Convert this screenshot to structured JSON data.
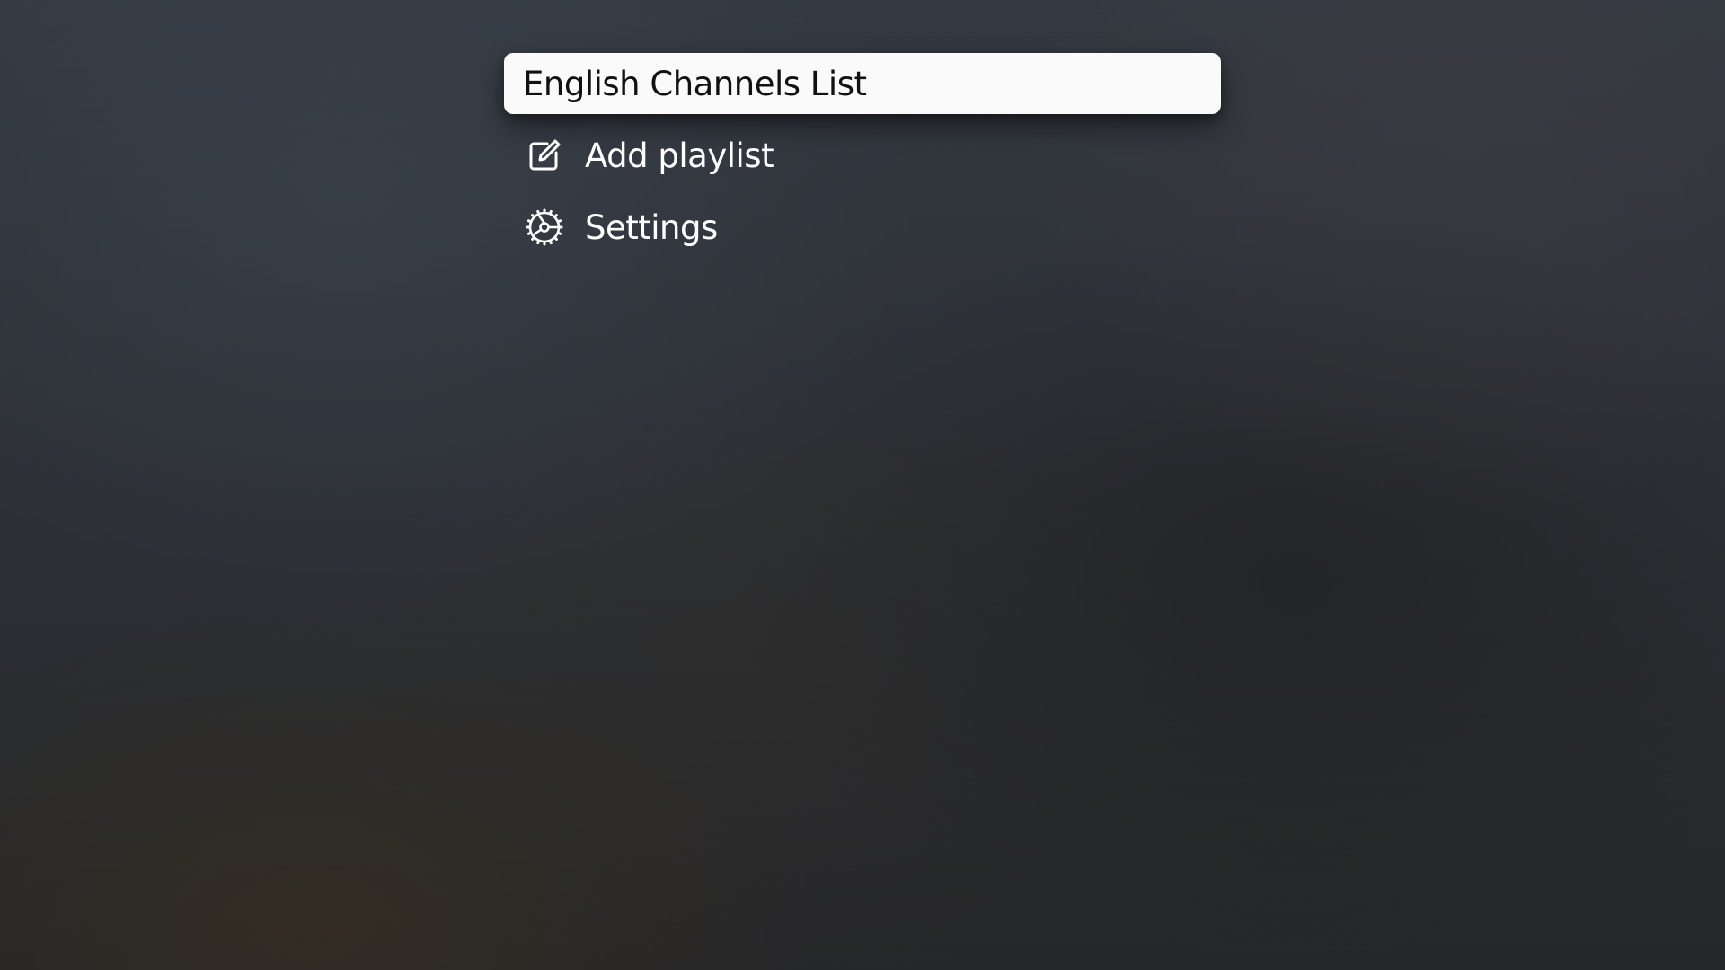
{
  "menu": {
    "items": [
      {
        "label": "English Channels List",
        "icon": null,
        "selected": true
      },
      {
        "label": "Add playlist",
        "icon": "edit-square-icon",
        "selected": false
      },
      {
        "label": "Settings",
        "icon": "gear-icon",
        "selected": false
      }
    ]
  },
  "colors": {
    "selected_background": "#fafafa",
    "selected_text": "#111111",
    "text": "#ffffff",
    "background": "#2d3136"
  }
}
